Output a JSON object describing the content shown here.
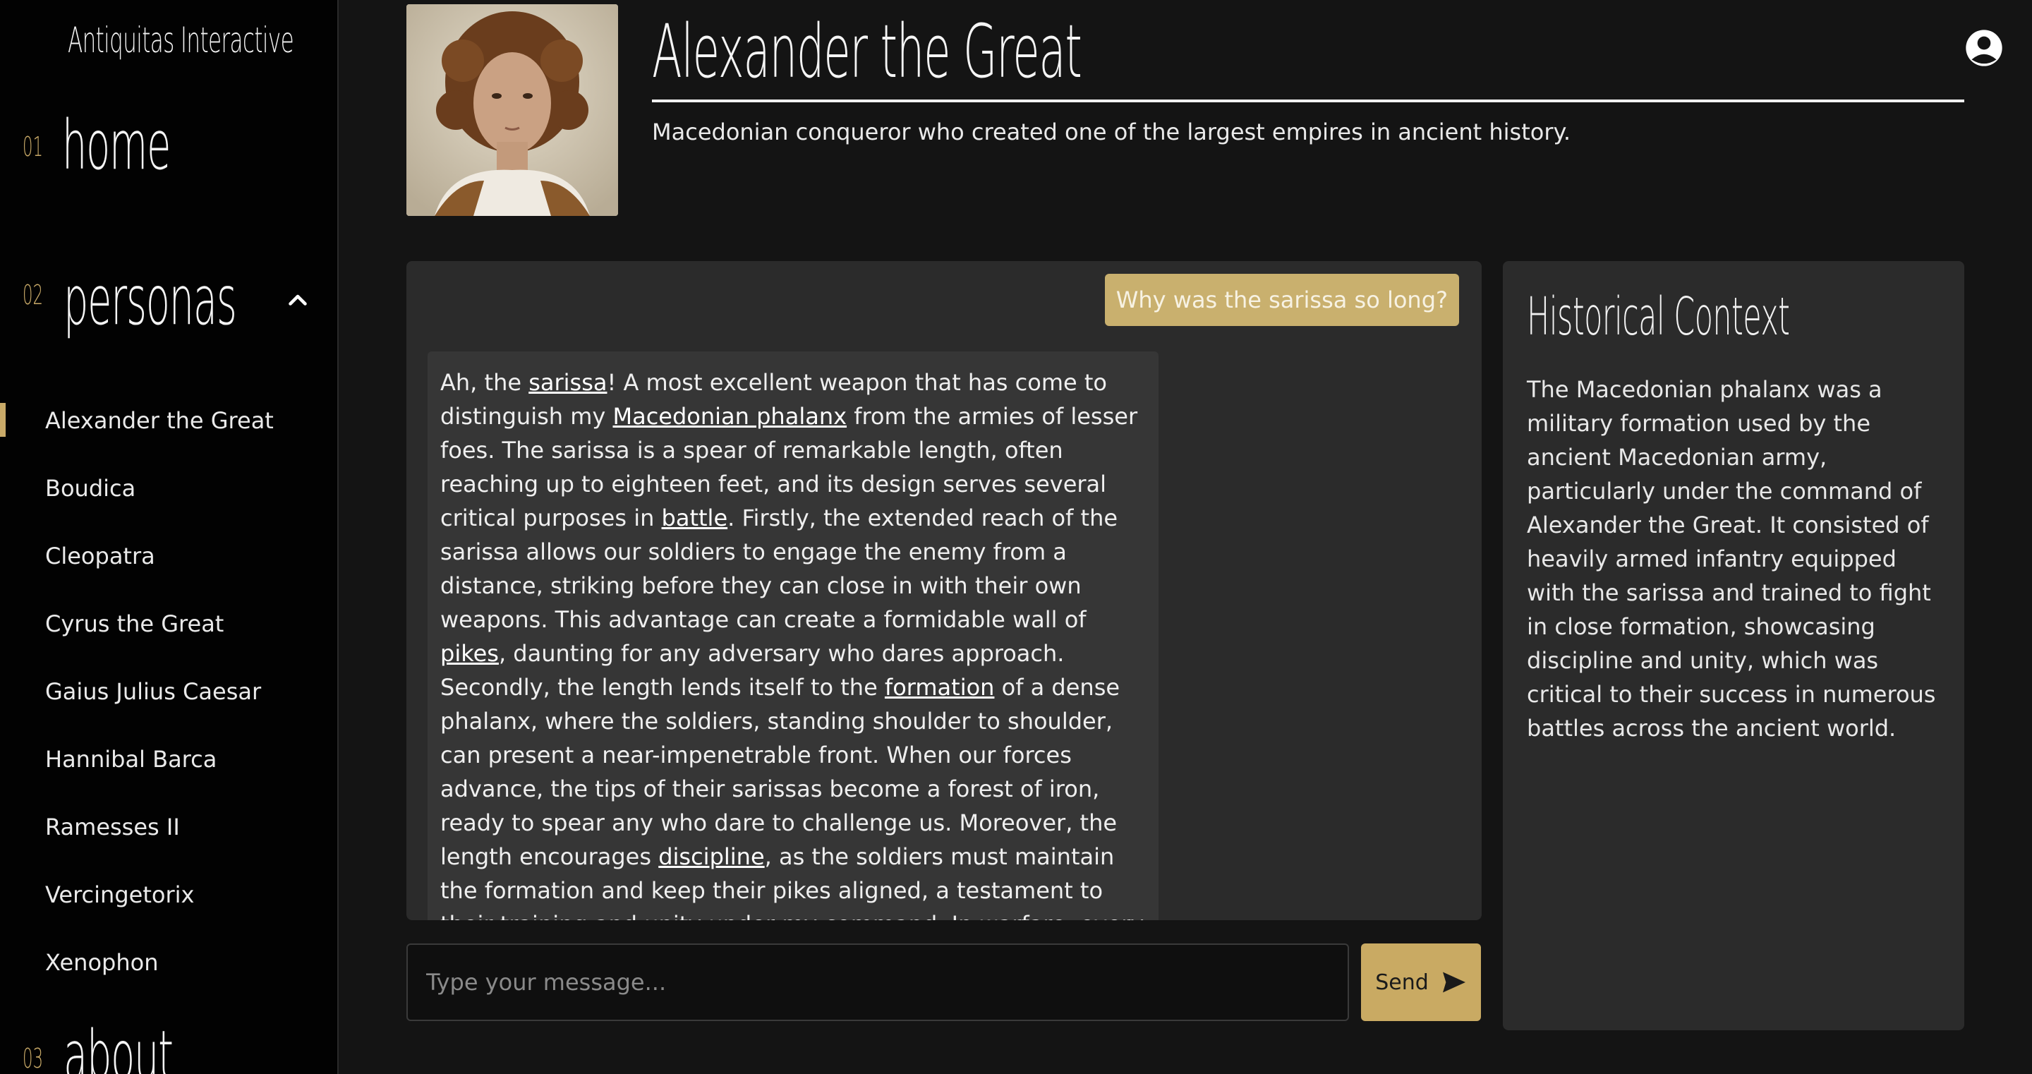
{
  "sidebar": {
    "brand": "Antiquitas Interactive",
    "nav": [
      {
        "num": "01",
        "label": "home"
      },
      {
        "num": "02",
        "label": "personas"
      },
      {
        "num": "03",
        "label": "about"
      }
    ],
    "personas": [
      {
        "label": "Alexander the Great",
        "active": true
      },
      {
        "label": "Boudica"
      },
      {
        "label": "Cleopatra"
      },
      {
        "label": "Cyrus the Great"
      },
      {
        "label": "Gaius Julius Caesar"
      },
      {
        "label": "Hannibal Barca"
      },
      {
        "label": "Ramesses II"
      },
      {
        "label": "Vercingetorix"
      },
      {
        "label": "Xenophon"
      }
    ]
  },
  "header": {
    "title": "Alexander the Great",
    "subtitle": "Macedonian conqueror who created one of the largest empires in ancient history."
  },
  "chat": {
    "user_message": "Why was the sarissa so long?",
    "reply_parts": [
      {
        "text": "Ah, the "
      },
      {
        "text": "sarissa",
        "link": true
      },
      {
        "text": "! A most excellent weapon that has come to distinguish my "
      },
      {
        "text": "Macedonian phalanx",
        "link": true
      },
      {
        "text": " from the armies of lesser foes. The sarissa is a spear of remarkable length, often reaching up to eighteen feet, and its design serves several critical purposes in "
      },
      {
        "text": "battle",
        "link": true
      },
      {
        "text": ". Firstly, the extended reach of the sarissa allows our soldiers to engage the enemy from a distance, striking before they can close in with their own weapons. This advantage can create a formidable wall of "
      },
      {
        "text": "pikes",
        "link": true
      },
      {
        "text": ", daunting for any adversary who dares approach. Secondly, the length lends itself to the "
      },
      {
        "text": "formation",
        "link": true
      },
      {
        "text": " of a dense phalanx, where the soldiers, standing shoulder to shoulder, can present a near-impenetrable front. When our forces advance, the tips of their sarissas become a forest of iron, ready to spear any who dare to challenge us. Moreover, the length encourages "
      },
      {
        "text": "discipline",
        "link": true
      },
      {
        "text": ", as the soldiers must maintain the formation and keep their pikes aligned, a testament to their training and unity under my command. In warfare, every"
      }
    ],
    "input_placeholder": "Type your message...",
    "send_label": "Send"
  },
  "context": {
    "title": "Historical Context",
    "body": "The Macedonian phalanx was a military formation used by the ancient Macedonian army, particularly under the command of Alexander the Great. It consisted of heavily armed infantry equipped with the sarissa and trained to fight in close formation, showcasing discipline and unity, which was critical to their success in numerous battles across the ancient world."
  },
  "colors": {
    "accent": "#c9aa68",
    "user_bubble": "#c9b06e",
    "panel": "#2b2b2b",
    "sidebar": "#020202"
  },
  "icons": {
    "chevron": "chevron-up-icon",
    "send": "send-arrow-icon",
    "account": "account-circle-icon"
  }
}
